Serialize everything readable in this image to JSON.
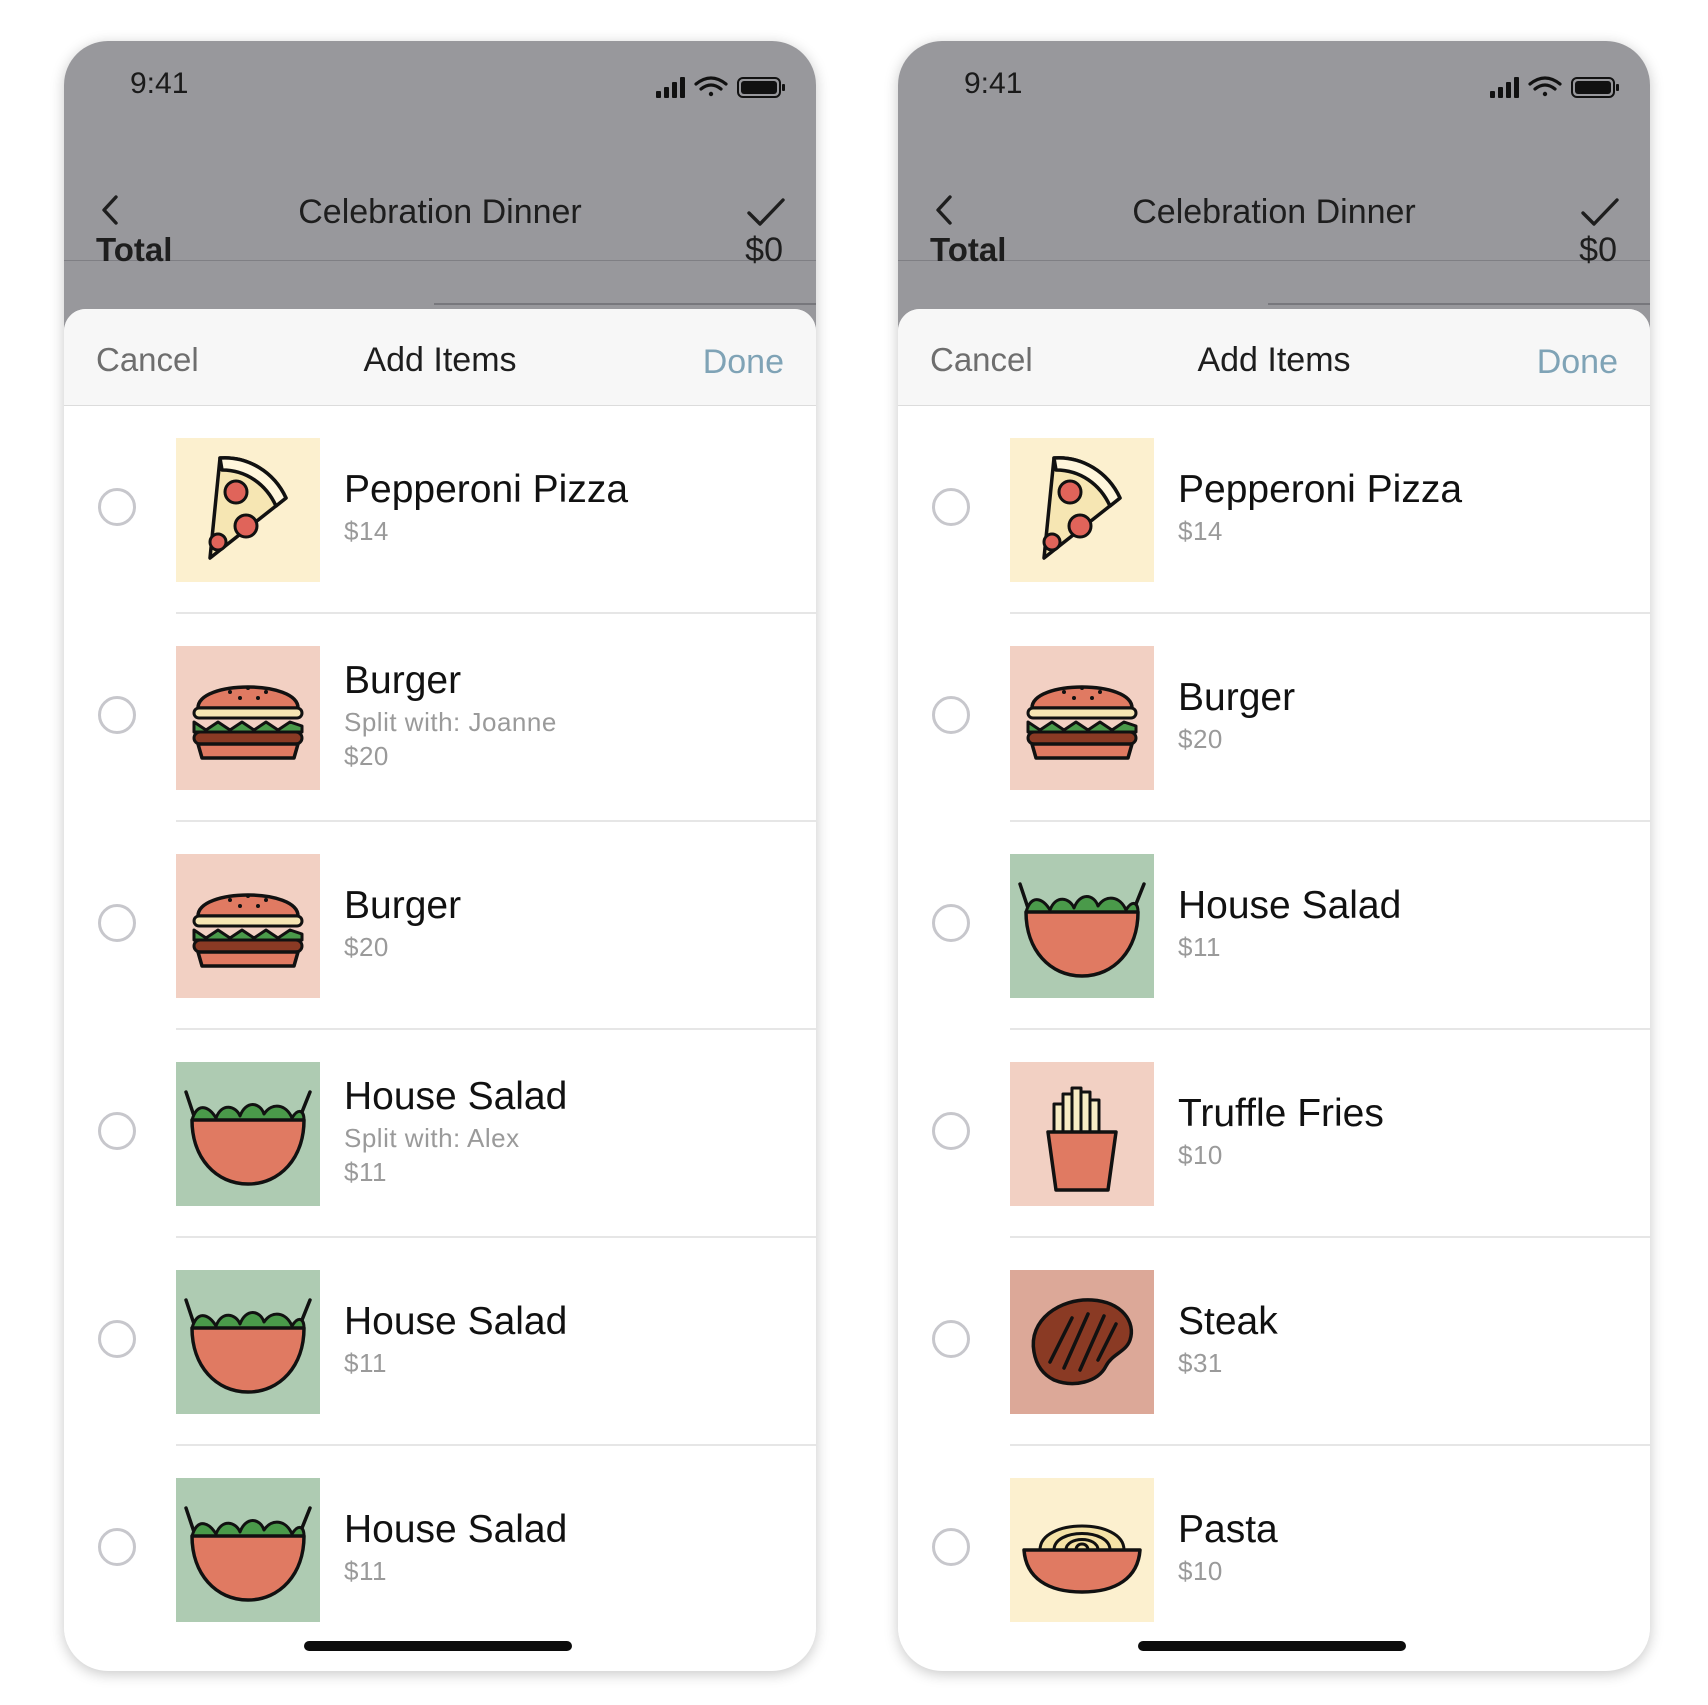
{
  "screens": [
    {
      "status_time": "9:41",
      "nav_title": "Celebration Dinner",
      "total_label": "Total",
      "total_value": "$0",
      "sheet": {
        "cancel": "Cancel",
        "title": "Add Items",
        "done": "Done"
      },
      "items": [
        {
          "name": "Pepperoni Pizza",
          "sub": "",
          "price": "$14",
          "icon": "pizza-icon",
          "bg": "#fcf0cf"
        },
        {
          "name": "Burger",
          "sub": "Split with: Joanne",
          "price": "$20",
          "icon": "burger-icon",
          "bg": "#f2d0c3"
        },
        {
          "name": "Burger",
          "sub": "",
          "price": "$20",
          "icon": "burger-icon",
          "bg": "#f2d0c3"
        },
        {
          "name": "House Salad",
          "sub": "Split with: Alex",
          "price": "$11",
          "icon": "salad-icon",
          "bg": "#aecbb2"
        },
        {
          "name": "House Salad",
          "sub": "",
          "price": "$11",
          "icon": "salad-icon",
          "bg": "#aecbb2"
        },
        {
          "name": "House Salad",
          "sub": "",
          "price": "$11",
          "icon": "salad-icon",
          "bg": "#aecbb2"
        }
      ]
    },
    {
      "status_time": "9:41",
      "nav_title": "Celebration Dinner",
      "total_label": "Total",
      "total_value": "$0",
      "sheet": {
        "cancel": "Cancel",
        "title": "Add Items",
        "done": "Done"
      },
      "items": [
        {
          "name": "Pepperoni Pizza",
          "sub": "",
          "price": "$14",
          "icon": "pizza-icon",
          "bg": "#fcf0cf"
        },
        {
          "name": "Burger",
          "sub": "",
          "price": "$20",
          "icon": "burger-icon",
          "bg": "#f2d0c3"
        },
        {
          "name": "House Salad",
          "sub": "",
          "price": "$11",
          "icon": "salad-icon",
          "bg": "#aecbb2"
        },
        {
          "name": "Truffle Fries",
          "sub": "",
          "price": "$10",
          "icon": "fries-icon",
          "bg": "#f2d0c3"
        },
        {
          "name": "Steak",
          "sub": "",
          "price": "$31",
          "icon": "steak-icon",
          "bg": "#dca898"
        },
        {
          "name": "Pasta",
          "sub": "",
          "price": "$10",
          "icon": "pasta-icon",
          "bg": "#fcf0cf"
        }
      ]
    }
  ]
}
